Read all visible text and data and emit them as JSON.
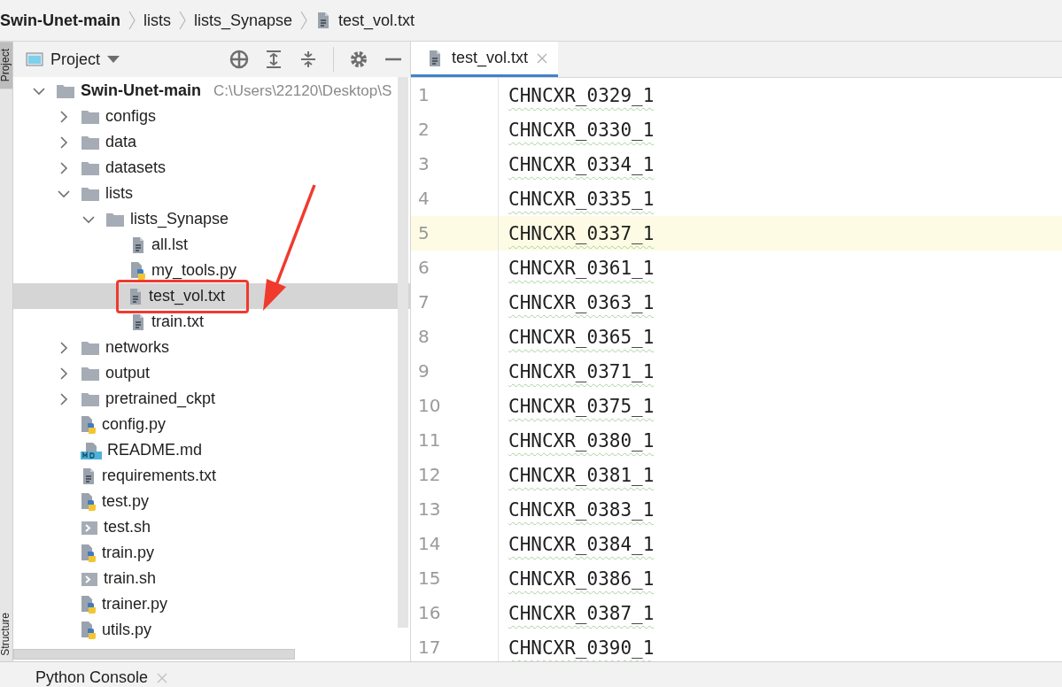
{
  "breadcrumbs": [
    {
      "label": "Swin-Unet-main",
      "kind": "root"
    },
    {
      "label": "lists",
      "kind": "folder"
    },
    {
      "label": "lists_Synapse",
      "kind": "folder"
    },
    {
      "label": "test_vol.txt",
      "kind": "text"
    }
  ],
  "side_strip": {
    "top_label": "Project",
    "bottom_label": "Structure"
  },
  "project_panel": {
    "title": "Project",
    "tree": [
      {
        "label": "Swin-Unet-main",
        "kind": "folder",
        "expanded": true,
        "selected": false,
        "path": "C:\\Users\\22120\\Desktop\\S",
        "children": [
          {
            "label": "configs",
            "kind": "folder",
            "expanded": false,
            "selected": false
          },
          {
            "label": "data",
            "kind": "folder",
            "expanded": false,
            "selected": false
          },
          {
            "label": "datasets",
            "kind": "folder",
            "expanded": false,
            "selected": false
          },
          {
            "label": "lists",
            "kind": "folder",
            "expanded": true,
            "selected": false,
            "children": [
              {
                "label": "lists_Synapse",
                "kind": "folder",
                "expanded": true,
                "selected": false,
                "children": [
                  {
                    "label": "all.lst",
                    "kind": "text",
                    "selected": false
                  },
                  {
                    "label": "my_tools.py",
                    "kind": "python",
                    "selected": false
                  },
                  {
                    "label": "test_vol.txt",
                    "kind": "text",
                    "selected": true,
                    "outlined": true
                  },
                  {
                    "label": "train.txt",
                    "kind": "text",
                    "selected": false
                  }
                ]
              }
            ]
          },
          {
            "label": "networks",
            "kind": "folder",
            "expanded": false,
            "selected": false
          },
          {
            "label": "output",
            "kind": "folder",
            "expanded": false,
            "selected": false
          },
          {
            "label": "pretrained_ckpt",
            "kind": "folder",
            "expanded": false,
            "selected": false
          },
          {
            "label": "config.py",
            "kind": "python",
            "selected": false
          },
          {
            "label": "README.md",
            "kind": "markdown",
            "selected": false
          },
          {
            "label": "requirements.txt",
            "kind": "text",
            "selected": false
          },
          {
            "label": "test.py",
            "kind": "python",
            "selected": false
          },
          {
            "label": "test.sh",
            "kind": "shell",
            "selected": false
          },
          {
            "label": "train.py",
            "kind": "python",
            "selected": false
          },
          {
            "label": "train.sh",
            "kind": "shell",
            "selected": false
          },
          {
            "label": "trainer.py",
            "kind": "python",
            "selected": false
          },
          {
            "label": "utils.py",
            "kind": "python",
            "selected": false
          }
        ]
      }
    ],
    "annotations": [
      {
        "kind": "arrow"
      }
    ]
  },
  "editor": {
    "tabs": [
      {
        "label": "test_vol.txt",
        "selected": true
      }
    ],
    "lines": [
      {
        "number": "1",
        "text": "CHNCXR_0329_1",
        "current": false
      },
      {
        "number": "2",
        "text": "CHNCXR_0330_1",
        "current": false
      },
      {
        "number": "3",
        "text": "CHNCXR_0334_1",
        "current": false
      },
      {
        "number": "4",
        "text": "CHNCXR_0335_1",
        "current": false
      },
      {
        "number": "5",
        "text": "CHNCXR_0337_1",
        "current": true
      },
      {
        "number": "6",
        "text": "CHNCXR_0361_1",
        "current": false
      },
      {
        "number": "7",
        "text": "CHNCXR_0363_1",
        "current": false
      },
      {
        "number": "8",
        "text": "CHNCXR_0365_1",
        "current": false
      },
      {
        "number": "9",
        "text": "CHNCXR_0371_1",
        "current": false
      },
      {
        "number": "10",
        "text": "CHNCXR_0375_1",
        "current": false
      },
      {
        "number": "11",
        "text": "CHNCXR_0380_1",
        "current": false
      },
      {
        "number": "12",
        "text": "CHNCXR_0381_1",
        "current": false
      },
      {
        "number": "13",
        "text": "CHNCXR_0383_1",
        "current": false
      },
      {
        "number": "14",
        "text": "CHNCXR_0384_1",
        "current": false
      },
      {
        "number": "15",
        "text": "CHNCXR_0386_1",
        "current": false
      },
      {
        "number": "16",
        "text": "CHNCXR_0387_1",
        "current": false
      },
      {
        "number": "17",
        "text": "CHNCXR_0390_1",
        "current": false
      }
    ]
  },
  "bottom_tabs": [
    {
      "label": "Python Console"
    }
  ]
}
